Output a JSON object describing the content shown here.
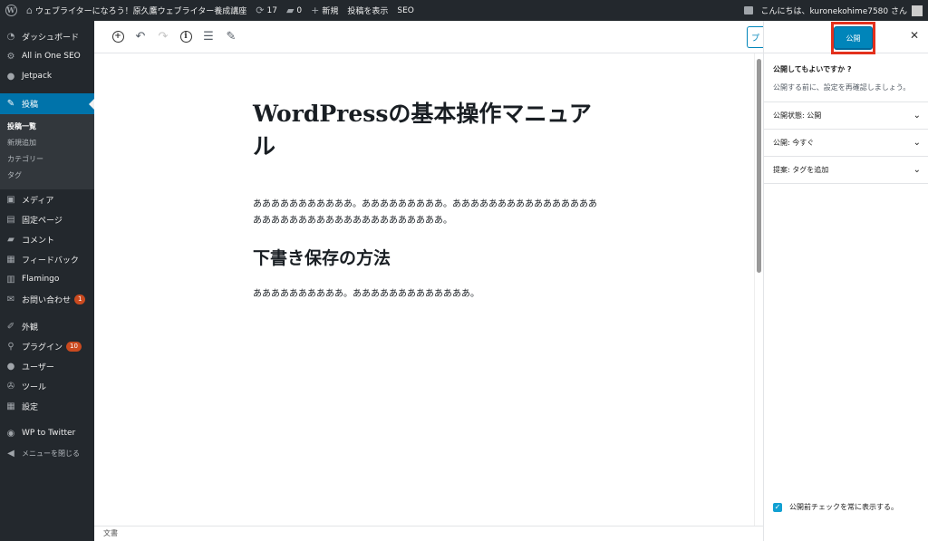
{
  "adminbar": {
    "site_name": "ウェブライターになろう！原久鷹ウェブライター養成講座",
    "updates": "17",
    "comments": "0",
    "new_label": "新規",
    "view_post": "投稿を表示",
    "seo": "SEO",
    "greeting": "こんにちは、kuronekohime7580 さん"
  },
  "sidebar": {
    "dashboard": "ダッシュボード",
    "aioseo": "All in One SEO",
    "jetpack": "Jetpack",
    "posts": "投稿",
    "posts_sub": [
      "投稿一覧",
      "新規追加",
      "カテゴリー",
      "タグ"
    ],
    "media": "メディア",
    "pages": "固定ページ",
    "comments": "コメント",
    "feedback": "フィードバック",
    "flamingo": "Flamingo",
    "contact": "お問い合わせ",
    "contact_badge": "1",
    "appearance": "外観",
    "plugins": "プラグイン",
    "plugins_badge": "10",
    "users": "ユーザー",
    "tools": "ツール",
    "settings": "設定",
    "wp_to_twitter": "WP to Twitter",
    "collapse": "メニューを閉じる"
  },
  "toolbar": {
    "preview_stub": "プ"
  },
  "editor": {
    "title": "WordPressの基本操作マニュアル",
    "paragraph1": "あああああああああああ。あああああああああ。あああああああああああああああああああああああああああああああああああああ。",
    "heading": "下書き保存の方法",
    "paragraph2": "ああああああああああ。あああああああああああああ。"
  },
  "footer": {
    "breadcrumb": "文書"
  },
  "panel": {
    "publish_label": "公開",
    "question": "公開してもよいですか ?",
    "subtext": "公開する前に、設定を再確認しましょう。",
    "visibility": "公開状態: 公開",
    "schedule": "公開: 今すぐ",
    "suggestion": "提案: タグを追加",
    "always_show": "公開前チェックを常に表示する。"
  },
  "colors": {
    "accent": "#0085ba",
    "highlight": "#e3301c",
    "admin_bg": "#23282d",
    "current_menu": "#0073aa",
    "badge": "#ca4a1f"
  }
}
